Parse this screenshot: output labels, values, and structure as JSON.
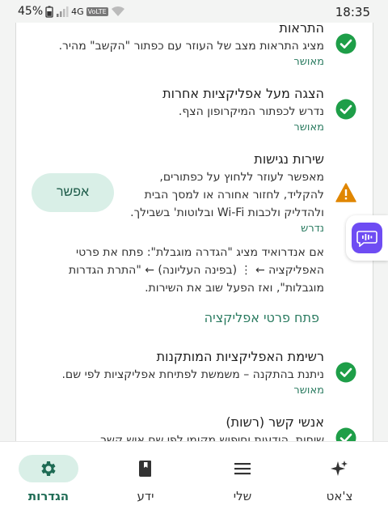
{
  "status_bar": {
    "battery": "45%",
    "network": "4G",
    "volte": "VoLTE",
    "time": "18:35"
  },
  "items": [
    {
      "title": "התראות",
      "desc": "מציג התראות מצב של העוזר עם כפתור \"הקשב\" מהיר.",
      "status": "מאושר",
      "icon": "check-circle-icon"
    },
    {
      "title": "הצגה מעל אפליקציות אחרות",
      "desc": "נדרש לכפתור המיקרופון הצף.",
      "status": "מאושר",
      "icon": "check-circle-icon"
    },
    {
      "title": "שירות נגישות",
      "desc_lines": [
        "מאפשר לעוזר ללחוץ על כפתורים,",
        "להקליד, לחזור אחורה או למסך הבית",
        "ולהדליק ולכבות Wi-Fi ובלוטות' בשבילך."
      ],
      "status": "נדרש",
      "icon": "warning-icon",
      "button": "אפשר",
      "note_lines": [
        "אם אנדרואיד מציג \"הגדרה מוגבלת\": פתח את פרטי",
        "האפליקציה ← ⋮ (בפינה העליונה) ← \"התרת הגדרות",
        "מוגבלות\", ואז הפעל שוב את השירות."
      ],
      "link": "פתח פרטי אפליקציה"
    },
    {
      "title": "רשימת האפליקציות המותקנות",
      "desc": "ניתנת בהתקנה – משמשת לפתיחת אפליקציות לפי שם.",
      "status": "מאושר",
      "icon": "check-circle-icon"
    },
    {
      "title": "אנשי קשר (רשות)",
      "desc": "שיחות, הודעות וחיפוש מקומי לפי שם איש קשר.",
      "icon": "check-circle-icon"
    }
  ],
  "nav": [
    {
      "label": "צ'אט",
      "icon": "sparkle-icon",
      "active": false
    },
    {
      "label": "שלי",
      "icon": "menu-icon",
      "active": false
    },
    {
      "label": "ידע",
      "icon": "book-icon",
      "active": false
    },
    {
      "label": "הגדרות",
      "icon": "gear-icon",
      "active": true
    }
  ],
  "colors": {
    "accent": "#2a7b60",
    "check": "#1e9e48",
    "warning": "#e08600",
    "fab": "#6e4cf3",
    "pill": "#d9efe7"
  }
}
